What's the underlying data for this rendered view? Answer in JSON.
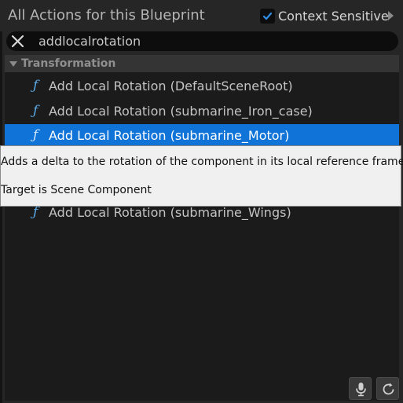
{
  "header": {
    "title": "All Actions for this Blueprint",
    "context_sensitive_label": "Context Sensitive",
    "context_sensitive_checked": true
  },
  "search": {
    "value": "addlocalrotation",
    "clear_icon": "close-icon"
  },
  "category": {
    "label": "Transformation",
    "expanded": true
  },
  "items": [
    {
      "label": "Add Local Rotation (DefaultSceneRoot)",
      "icon": "function-icon"
    },
    {
      "label": "Add Local Rotation (submarine_Iron_case)",
      "icon": "function-icon"
    },
    {
      "label": "Add Local Rotation (submarine_Motor)",
      "icon": "function-icon",
      "selected": true
    },
    {
      "label": "Add Local Rotation (submarine_Wings)",
      "icon": "function-icon"
    }
  ],
  "tooltip": {
    "description": "Adds a delta to the rotation of the component in its local reference frame",
    "target": "Target is Scene Component"
  },
  "footer": {
    "mic_icon": "microphone-icon",
    "refresh_icon": "refresh-icon"
  },
  "colors": {
    "selection": "#0f73d8",
    "function_icon": "#5aaae8",
    "checkbox_check": "#2f8ee6"
  }
}
